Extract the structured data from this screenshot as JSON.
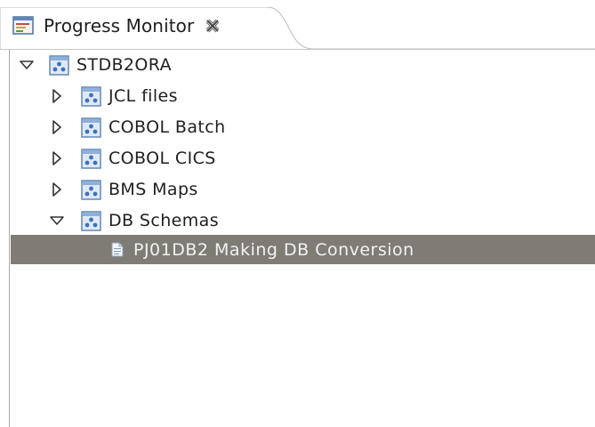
{
  "view": {
    "title": "Progress Monitor"
  },
  "tree": {
    "root": {
      "label": "STDB2ORA",
      "expanded": true
    },
    "children": [
      {
        "label": "JCL files",
        "expanded": false
      },
      {
        "label": "COBOL Batch",
        "expanded": false
      },
      {
        "label": "COBOL CICS",
        "expanded": false
      },
      {
        "label": "BMS Maps",
        "expanded": false
      },
      {
        "label": "DB Schemas",
        "expanded": true
      }
    ],
    "selected_item": {
      "label": "PJ01DB2 Making DB Conversion"
    }
  },
  "colors": {
    "selection": "#7f7c75",
    "icon_blue": "#3d72b8"
  }
}
